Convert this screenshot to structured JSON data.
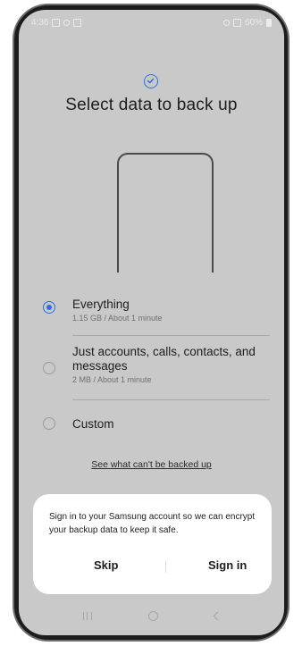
{
  "status_bar": {
    "time": "4:36",
    "battery": "60%"
  },
  "page": {
    "title": "Select data to back up"
  },
  "options": [
    {
      "label": "Everything",
      "sub": "1.15 GB / About 1 minute",
      "selected": true
    },
    {
      "label": "Just accounts, calls, contacts, and messages",
      "sub": "2 MB / About 1 minute",
      "selected": false
    },
    {
      "label": "Custom",
      "sub": "",
      "selected": false
    }
  ],
  "link": {
    "text": "See what can't be backed up"
  },
  "dialog": {
    "message": "Sign in to your Samsung account so we can encrypt your backup data to keep it safe.",
    "skip_label": "Skip",
    "signin_label": "Sign in"
  },
  "colors": {
    "accent": "#2d6fe0",
    "overlay": "#c9c9c9",
    "dialog_bg": "#ffffff"
  },
  "icons": [
    "check-circle-icon",
    "recents-icon",
    "home-icon",
    "back-icon"
  ]
}
